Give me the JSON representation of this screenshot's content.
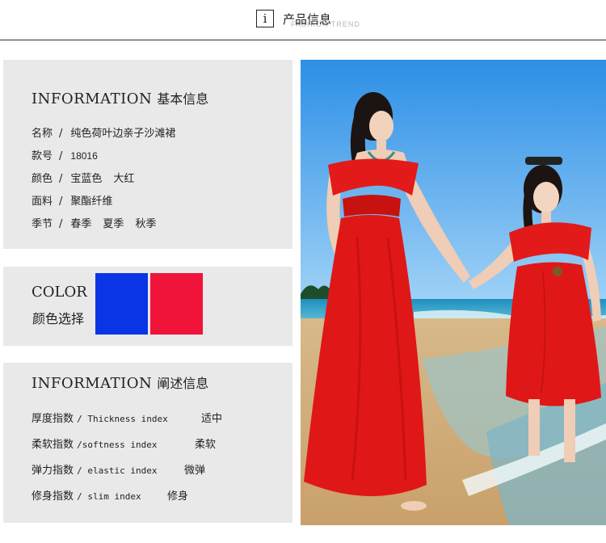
{
  "header": {
    "icon_glyph": "i",
    "title": "产品信息",
    "watermark": "FASHION TREND"
  },
  "info_panel": {
    "heading_en": "INFORMATION",
    "heading_cn": "基本信息",
    "rows": [
      {
        "label": "名称",
        "value": "纯色荷叶边亲子沙滩裙"
      },
      {
        "label": "款号",
        "value": "18016"
      },
      {
        "label": "颜色",
        "value": "宝蓝色",
        "value2": "大红"
      },
      {
        "label": "面料",
        "value": "聚酯纤维"
      },
      {
        "label": "季节",
        "value": "春季",
        "value2": "夏季",
        "value3": "秋季"
      }
    ],
    "separator": "/"
  },
  "color_panel": {
    "label_en": "COLOR",
    "label_cn": "颜色选择",
    "swatches": [
      {
        "name": "宝蓝色",
        "color": "#0a35e6"
      },
      {
        "name": "大红",
        "color": "#f0133a"
      }
    ]
  },
  "index_panel": {
    "heading_en": "INFORMATION",
    "heading_cn": "阐述信息",
    "rows": [
      {
        "cn": "厚度指数",
        "en": "/ Thickness index",
        "level": "适中"
      },
      {
        "cn": "柔软指数",
        "en": "/softness index",
        "level": "柔软"
      },
      {
        "cn": "弹力指数",
        "en": "/ elastic index",
        "level": "微弹"
      },
      {
        "cn": "修身指数",
        "en": "/ slim index",
        "level": "修身"
      }
    ]
  },
  "photo": {
    "icon": "mother-daughter-beach-photo"
  }
}
